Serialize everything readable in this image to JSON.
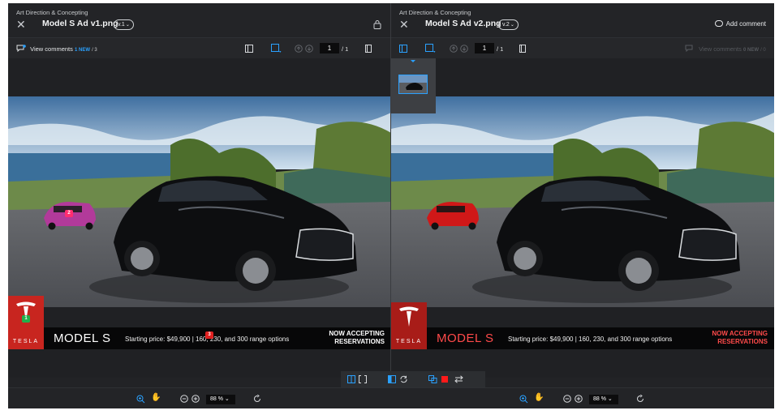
{
  "left": {
    "breadcrumb": "Art Direction & Concepting",
    "title": "Model S Ad v1.png",
    "version": "v.1",
    "comments": {
      "label": "View comments",
      "new_count": "1 NEW",
      "total": "/ 3"
    },
    "page": {
      "current": "1",
      "total": "/ 1"
    },
    "ad": {
      "brand_word": "TESLA",
      "model": "MODEL S",
      "price": "Starting price: $49,900  |  160, 230, and 300 range options",
      "cta_line1": "NOW ACCEPTING",
      "cta_line2": "RESERVATIONS"
    },
    "pins": [
      "2",
      "1",
      "3"
    ],
    "zoom": "88 %"
  },
  "right": {
    "breadcrumb": "Art Direction & Concepting",
    "title": "Model S Ad v2.png",
    "version": "v.2",
    "add_comment": "Add comment",
    "comments": {
      "label": "View comments",
      "new_count": "0 NEW",
      "total": "/ 0"
    },
    "page": {
      "current": "1",
      "total": "/ 1"
    },
    "ad": {
      "brand_word": "TESLA",
      "model": "MODEL S",
      "price": "Starting price: $49,900  |  160, 230, and 300 range options",
      "cta_line1": "NOW ACCEPTING",
      "cta_line2": "RESERVATIONS"
    },
    "zoom": "88 %"
  },
  "icons": {
    "close": "close-icon",
    "lock": "lock-icon",
    "comment": "comment-bubble-icon",
    "zoom_in": "zoom-in-icon",
    "hand": "hand-pan-icon",
    "zoom_out": "zoom-out-icon",
    "rotate": "rotate-icon"
  },
  "colors": {
    "accent": "#2aa1ff",
    "background": "#222326",
    "pin_magenta": "#ff2d6f",
    "pin_green": "#22b04b",
    "pin_red": "#e02020",
    "v2_car": "#d01818",
    "tesla_red": "#c8251f"
  }
}
